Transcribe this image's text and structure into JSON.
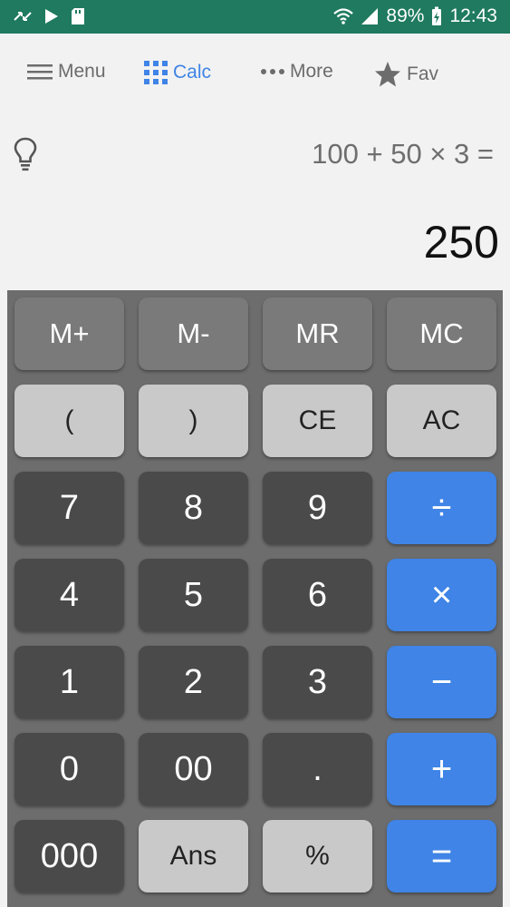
{
  "status_bar": {
    "battery": "89%",
    "time": "12:43"
  },
  "nav": {
    "menu": "Menu",
    "calc": "Calc",
    "more": "More",
    "fav": "Fav"
  },
  "display": {
    "expression": "100 + 50 × 3 =",
    "result": "250"
  },
  "keys": {
    "m_plus": "M+",
    "m_minus": "M-",
    "mr": "MR",
    "mc": "MC",
    "lparen": "(",
    "rparen": ")",
    "ce": "CE",
    "ac": "AC",
    "seven": "7",
    "eight": "8",
    "nine": "9",
    "divide": "÷",
    "four": "4",
    "five": "5",
    "six": "6",
    "multiply": "×",
    "one": "1",
    "two": "2",
    "three": "3",
    "minus": "−",
    "zero": "0",
    "double_zero": "00",
    "dot": ".",
    "plus": "+",
    "triple_zero": "000",
    "ans": "Ans",
    "percent": "%",
    "equals": "="
  },
  "colors": {
    "status_bar": "#1f7a5f",
    "accent": "#3f84e6",
    "keypad_bg": "#6d6d6d"
  }
}
